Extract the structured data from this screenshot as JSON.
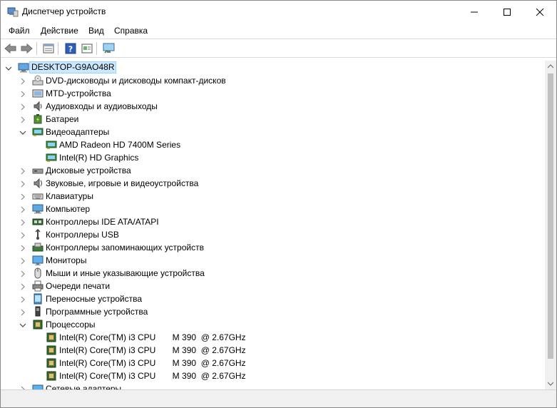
{
  "window": {
    "title": "Диспетчер устройств"
  },
  "menu": [
    "Файл",
    "Действие",
    "Вид",
    "Справка"
  ],
  "toolbar": [
    "back-icon",
    "forward-icon",
    "properties-icon",
    "help-icon",
    "update-driver-icon",
    "scan-hardware-icon"
  ],
  "tree": {
    "root": "DESKTOP-G9AO48R",
    "categories": [
      {
        "label": "DVD-дисководы и дисководы компакт-дисков",
        "icon": "dvd-drive-icon",
        "expanded": false
      },
      {
        "label": "MTD-устройства",
        "icon": "mtd-device-icon",
        "expanded": false
      },
      {
        "label": "Аудиовходы и аудиовыходы",
        "icon": "speaker-icon",
        "expanded": false
      },
      {
        "label": "Батареи",
        "icon": "battery-icon",
        "expanded": false
      },
      {
        "label": "Видеоадаптеры",
        "icon": "display-adapter-icon",
        "expanded": true,
        "children": [
          "AMD Radeon HD 7400M Series",
          "Intel(R) HD Graphics"
        ]
      },
      {
        "label": "Дисковые устройства",
        "icon": "disk-drive-icon",
        "expanded": false
      },
      {
        "label": "Звуковые, игровые и видеоустройства",
        "icon": "sound-icon",
        "expanded": false
      },
      {
        "label": "Клавиатуры",
        "icon": "keyboard-icon",
        "expanded": false
      },
      {
        "label": "Компьютер",
        "icon": "computer-icon",
        "expanded": false
      },
      {
        "label": "Контроллеры IDE ATA/ATAPI",
        "icon": "ide-controller-icon",
        "expanded": false
      },
      {
        "label": "Контроллеры USB",
        "icon": "usb-icon",
        "expanded": false
      },
      {
        "label": "Контроллеры запоминающих устройств",
        "icon": "storage-controller-icon",
        "expanded": false
      },
      {
        "label": "Мониторы",
        "icon": "monitor-icon",
        "expanded": false
      },
      {
        "label": "Мыши и иные указывающие устройства",
        "icon": "mouse-icon",
        "expanded": false
      },
      {
        "label": "Очереди печати",
        "icon": "printer-icon",
        "expanded": false
      },
      {
        "label": "Переносные устройства",
        "icon": "portable-device-icon",
        "expanded": false
      },
      {
        "label": "Программные устройства",
        "icon": "software-device-icon",
        "expanded": false
      },
      {
        "label": "Процессоры",
        "icon": "processor-icon",
        "expanded": true,
        "children": [
          "Intel(R) Core(TM) i3 CPU       M 390  @ 2.67GHz",
          "Intel(R) Core(TM) i3 CPU       M 390  @ 2.67GHz",
          "Intel(R) Core(TM) i3 CPU       M 390  @ 2.67GHz",
          "Intel(R) Core(TM) i3 CPU       M 390  @ 2.67GHz"
        ]
      },
      {
        "label": "Сетевые адаптеры",
        "icon": "network-adapter-icon",
        "expanded": false
      }
    ]
  },
  "colors": {
    "selection": "#cce8ff",
    "selection_border": "#99d1ff"
  }
}
